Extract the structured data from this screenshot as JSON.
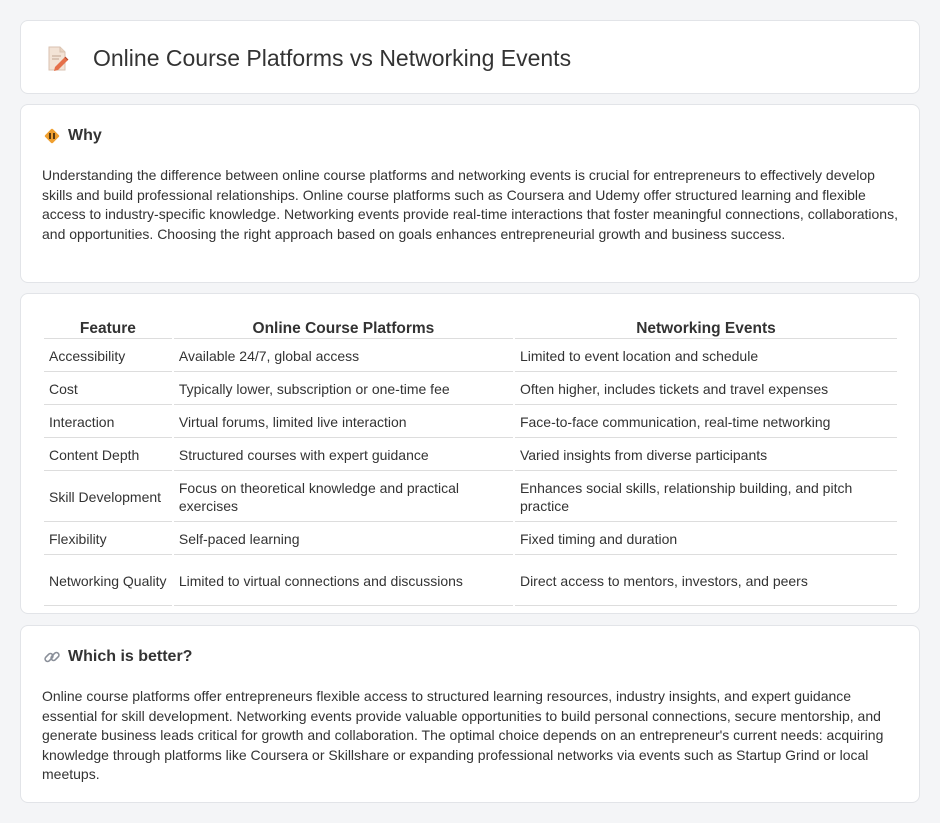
{
  "page": {
    "title": "Online Course Platforms vs Networking Events",
    "title_icon": "document-pencil-icon"
  },
  "why": {
    "icon": "diamond-road-sign-icon",
    "heading": "Why",
    "text": "Understanding the difference between online course platforms and networking events is crucial for entrepreneurs to effectively develop skills and build professional relationships. Online course platforms such as Coursera and Udemy offer structured learning and flexible access to industry-specific knowledge. Networking events provide real-time interactions that foster meaningful connections, collaborations, and opportunities. Choosing the right approach based on goals enhances entrepreneurial growth and business success."
  },
  "comparison": {
    "headers": [
      "Feature",
      "Online Course Platforms",
      "Networking Events"
    ],
    "rows": [
      [
        "Accessibility",
        "Available 24/7, global access",
        "Limited to event location and schedule"
      ],
      [
        "Cost",
        "Typically lower, subscription or one-time fee",
        "Often higher, includes tickets and travel expenses"
      ],
      [
        "Interaction",
        "Virtual forums, limited live interaction",
        "Face-to-face communication, real-time networking"
      ],
      [
        "Content Depth",
        "Structured courses with expert guidance",
        "Varied insights from diverse participants"
      ],
      [
        "Skill Development",
        "Focus on theoretical knowledge and practical exercises",
        "Enhances social skills, relationship building, and pitch practice"
      ],
      [
        "Flexibility",
        "Self-paced learning",
        "Fixed timing and duration"
      ],
      [
        "Networking Quality",
        "Limited to virtual connections and discussions",
        "Direct access to mentors, investors, and peers"
      ]
    ]
  },
  "better": {
    "icon": "link-icon",
    "heading": "Which is better?",
    "text": "Online course platforms offer entrepreneurs flexible access to structured learning resources, industry insights, and expert guidance essential for skill development. Networking events provide valuable opportunities to build personal connections, secure mentorship, and generate business leads critical for growth and collaboration. The optimal choice depends on an entrepreneur's current needs: acquiring knowledge through platforms like Coursera or Skillshare or expanding professional networks via events such as Startup Grind or local meetups."
  },
  "colors": {
    "background": "#f4f5f7",
    "card": "#ffffff",
    "text": "#333333",
    "icon_orange": "#f0a030",
    "icon_pencil": "#e5704a"
  }
}
